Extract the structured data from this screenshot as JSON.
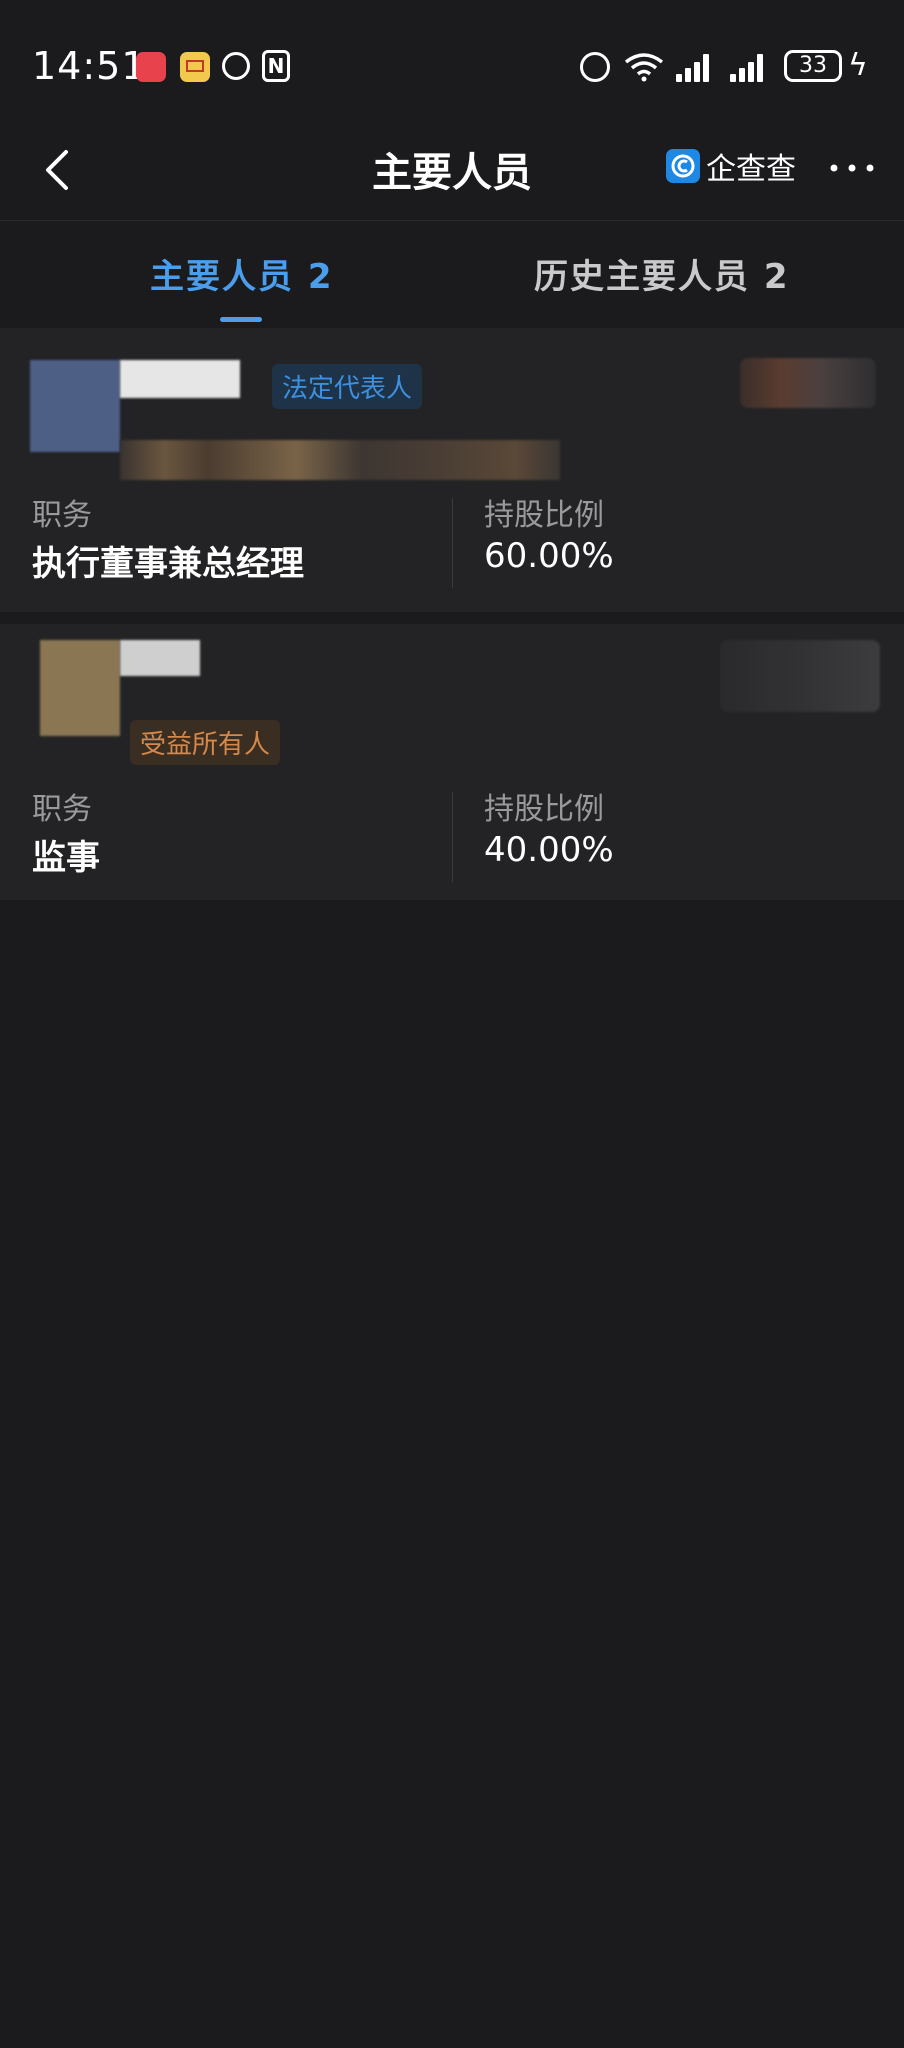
{
  "status_bar": {
    "time": "14:51",
    "battery": "33"
  },
  "nav": {
    "title": "主要人员",
    "brand": "企查查"
  },
  "tabs": [
    {
      "label": "主要人员 2",
      "active": true
    },
    {
      "label": "历史主要人员 2",
      "active": false
    }
  ],
  "people": [
    {
      "badge": "法定代表人",
      "position_label": "职务",
      "position": "执行董事兼总经理",
      "share_label": "持股比例",
      "share": "60.00%"
    },
    {
      "badge": "受益所有人",
      "position_label": "职务",
      "position": "监事",
      "share_label": "持股比例",
      "share": "40.00%"
    }
  ],
  "colors": {
    "background": "#1b1b1d",
    "card": "#232325",
    "accent": "#4a9eec",
    "legal_badge_text": "#3d8fe0",
    "owner_badge_text": "#d4894a"
  }
}
